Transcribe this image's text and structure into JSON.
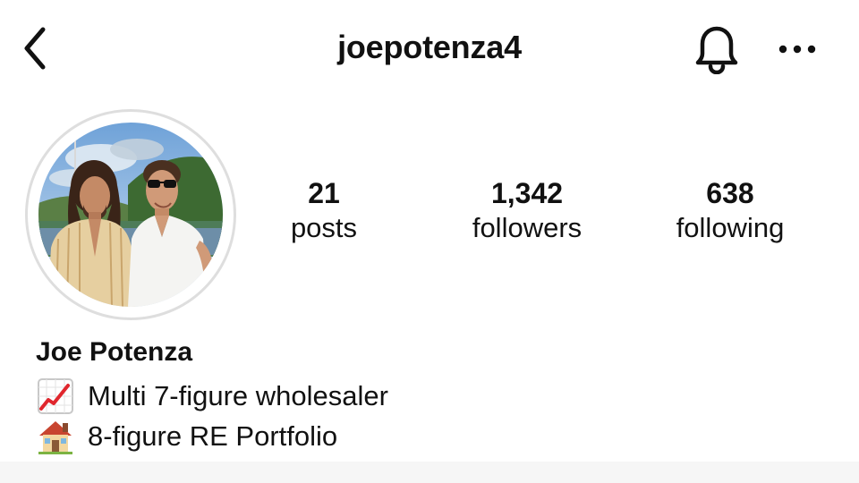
{
  "header": {
    "username": "joepotenza4",
    "back_icon": "chevron-left-icon",
    "notification_icon": "bell-icon",
    "more_icon": "ellipsis-icon"
  },
  "profile": {
    "avatar_description": "profile-photo",
    "stats": {
      "posts": {
        "value": "21",
        "label": "posts"
      },
      "followers": {
        "value": "1,342",
        "label": "followers"
      },
      "following": {
        "value": "638",
        "label": "following"
      }
    }
  },
  "bio": {
    "name": "Joe Potenza",
    "lines": [
      {
        "icon": "chart-increasing-emoji",
        "text": "Multi 7-figure wholesaler"
      },
      {
        "icon": "house-emoji",
        "text": "8-figure RE Portfolio"
      }
    ]
  },
  "colors": {
    "text": "#111111",
    "avatar_ring": "#dedede",
    "background": "#ffffff"
  }
}
